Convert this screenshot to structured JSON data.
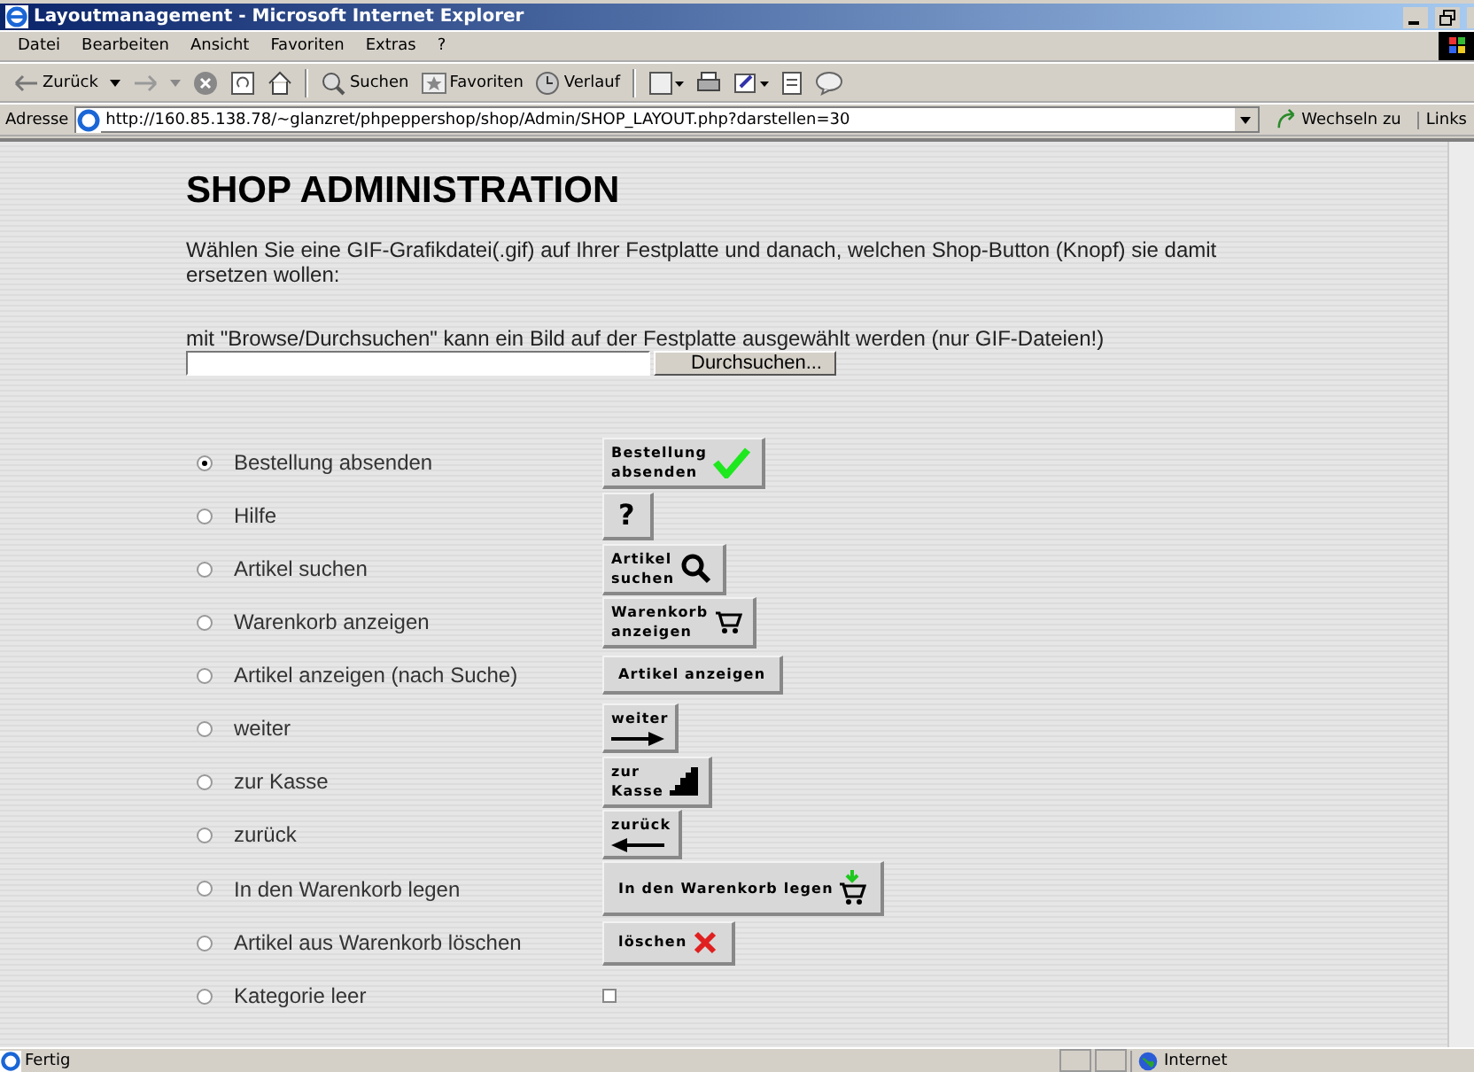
{
  "window": {
    "title": "Layoutmanagement - Microsoft Internet Explorer"
  },
  "menu": [
    "Datei",
    "Bearbeiten",
    "Ansicht",
    "Favoriten",
    "Extras",
    "?"
  ],
  "toolbar": {
    "back": "Zurück",
    "search": "Suchen",
    "favorites": "Favoriten",
    "history": "Verlauf"
  },
  "address": {
    "label": "Adresse",
    "url": "http://160.85.138.78/~glanzret/phpeppershop/shop/Admin/SHOP_LAYOUT.php?darstellen=30",
    "go": "Wechseln zu",
    "links": "Links"
  },
  "page": {
    "heading": "SHOP ADMINISTRATION",
    "intro": "Wählen Sie eine GIF-Grafikdatei(.gif) auf Ihrer Festplatte und danach, welchen Shop-Button (Knopf) sie damit ersetzen wollen:",
    "upload_hint": "mit \"Browse/Durchsuchen\" kann ein Bild auf der Festplatte ausgewählt werden (nur GIF-Dateien!)",
    "browse_button": "Durchsuchen...",
    "options": [
      {
        "label": "Bestellung absenden",
        "selected": true,
        "button": [
          "Bestellung",
          "absenden"
        ],
        "kind": "check"
      },
      {
        "label": "Hilfe",
        "selected": false,
        "button": [
          "?"
        ],
        "kind": "plain"
      },
      {
        "label": "Artikel suchen",
        "selected": false,
        "button": [
          "Artikel",
          "suchen"
        ],
        "kind": "search"
      },
      {
        "label": "Warenkorb anzeigen",
        "selected": false,
        "button": [
          "Warenkorb",
          "anzeigen"
        ],
        "kind": "cart"
      },
      {
        "label": "Artikel anzeigen (nach Suche)",
        "selected": false,
        "button": [
          "Artikel anzeigen"
        ],
        "kind": "plain"
      },
      {
        "label": "weiter",
        "selected": false,
        "button": [
          "weiter"
        ],
        "kind": "forward"
      },
      {
        "label": "zur Kasse",
        "selected": false,
        "button": [
          "zur",
          "Kasse"
        ],
        "kind": "checkout"
      },
      {
        "label": "zurück",
        "selected": false,
        "button": [
          "zurück"
        ],
        "kind": "back"
      },
      {
        "label": "In den Warenkorb legen",
        "selected": false,
        "button": [
          "In den Warenkorb legen"
        ],
        "kind": "add"
      },
      {
        "label": "Artikel aus Warenkorb löschen",
        "selected": false,
        "button": [
          "löschen"
        ],
        "kind": "delete"
      },
      {
        "label": "Kategorie leer",
        "selected": false,
        "kind": "empty"
      }
    ]
  },
  "status_bar": {
    "text": "Fertig",
    "zone": "Internet"
  }
}
